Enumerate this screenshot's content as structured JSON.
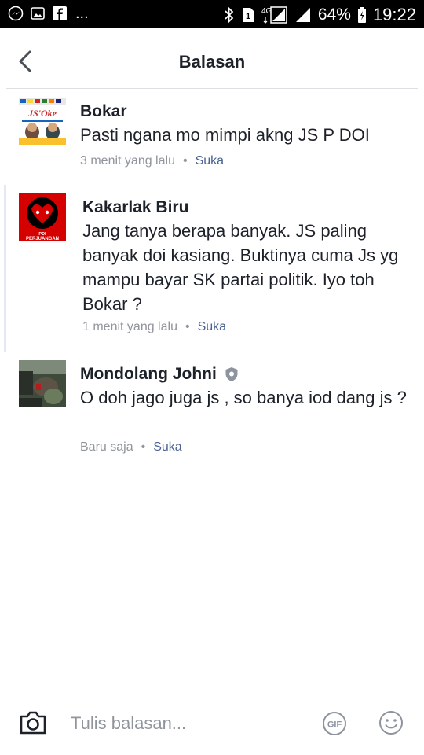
{
  "status_bar": {
    "left_icons": [
      "messenger-icon",
      "gallery-icon",
      "facebook-icon"
    ],
    "overflow": "...",
    "right_icons": [
      "bluetooth-icon",
      "sim-1-icon",
      "4g-signal-icon",
      "signal-icon",
      "battery-icon"
    ],
    "network": "4G",
    "battery": "64%",
    "time": "19:22"
  },
  "header": {
    "title": "Balasan",
    "back_icon": "chevron-left-icon"
  },
  "comments": [
    {
      "name": "Bokar",
      "text": "Pasti ngana mo mimpi akng JS P DOI",
      "time": "3 menit yang lalu",
      "dot": "•",
      "like": "Suka",
      "avatar_label": "JS'Oke"
    },
    {
      "name": "Kakarlak Biru",
      "text": "Jang tanya berapa banyak. JS paling banyak doi kasiang. Buktinya cuma Js yg mampu bayar SK partai politik. Iyo toh Bokar ?",
      "time": "1 menit yang lalu",
      "dot": "•",
      "like": "Suka",
      "avatar_label": "PDI PERJUANGAN"
    },
    {
      "name": "Mondolang Johni",
      "text": "O doh jago juga js , so banya iod dang js ?",
      "time": "Baru saja",
      "dot": "•",
      "like": "Suka",
      "badge_icon": "shield-badge-icon"
    }
  ],
  "compose": {
    "placeholder": "Tulis balasan...",
    "camera_icon": "camera-icon",
    "gif_label": "GIF",
    "emoji_icon": "smiley-icon"
  },
  "colors": {
    "text": "#1d2129",
    "meta": "#90949c",
    "link": "#4b6295",
    "divider": "#dddfe2"
  }
}
